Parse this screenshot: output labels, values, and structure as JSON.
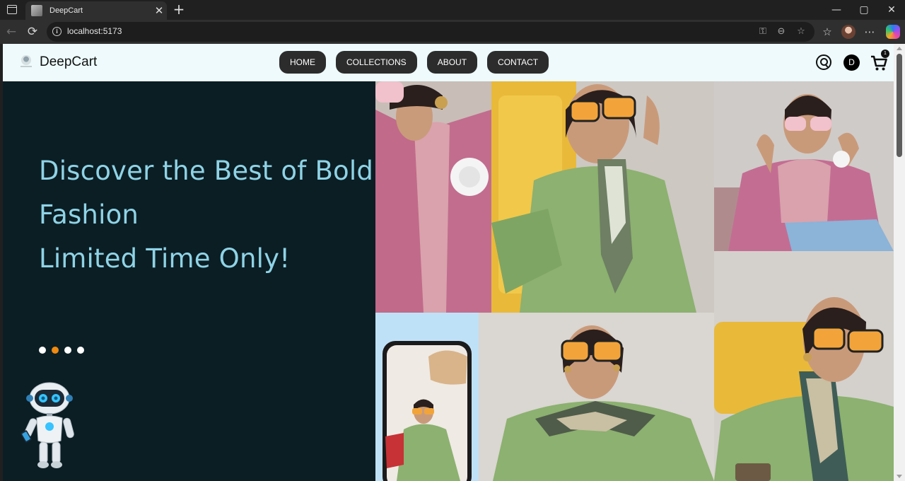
{
  "browser": {
    "tab_title": "DeepCart",
    "tab_close": "✕",
    "new_tab": "+",
    "url": "localhost:5173",
    "window_controls": {
      "minimize": "—",
      "maximize": "▢",
      "close": "✕"
    },
    "icons": {
      "back": "back-arrow-icon",
      "refresh": "refresh-icon",
      "site_info": "info-icon",
      "key": "key-icon",
      "zoom": "zoom-out-icon",
      "favorite": "star-icon",
      "favorites_list": "favorites-icon",
      "more": "more-icon"
    }
  },
  "site": {
    "brand": "DeepCart",
    "nav": [
      "HOME",
      "COLLECTIONS",
      "ABOUT",
      "CONTACT"
    ],
    "avatar_initial": "D",
    "cart_count": "1",
    "icons": {
      "search": "search-icon",
      "cart": "cart-icon"
    }
  },
  "hero": {
    "lines": [
      "Discover the Best of Bold",
      "Fashion",
      "Limited Time Only!"
    ],
    "slide_count": 4,
    "active_slide": 2
  },
  "colors": {
    "hero_bg": "#0b1e24",
    "hero_text": "#8fd3e6",
    "header_bg": "#eefafb",
    "nav_button": "#2c2c2c",
    "active_dot": "#f08a10"
  }
}
